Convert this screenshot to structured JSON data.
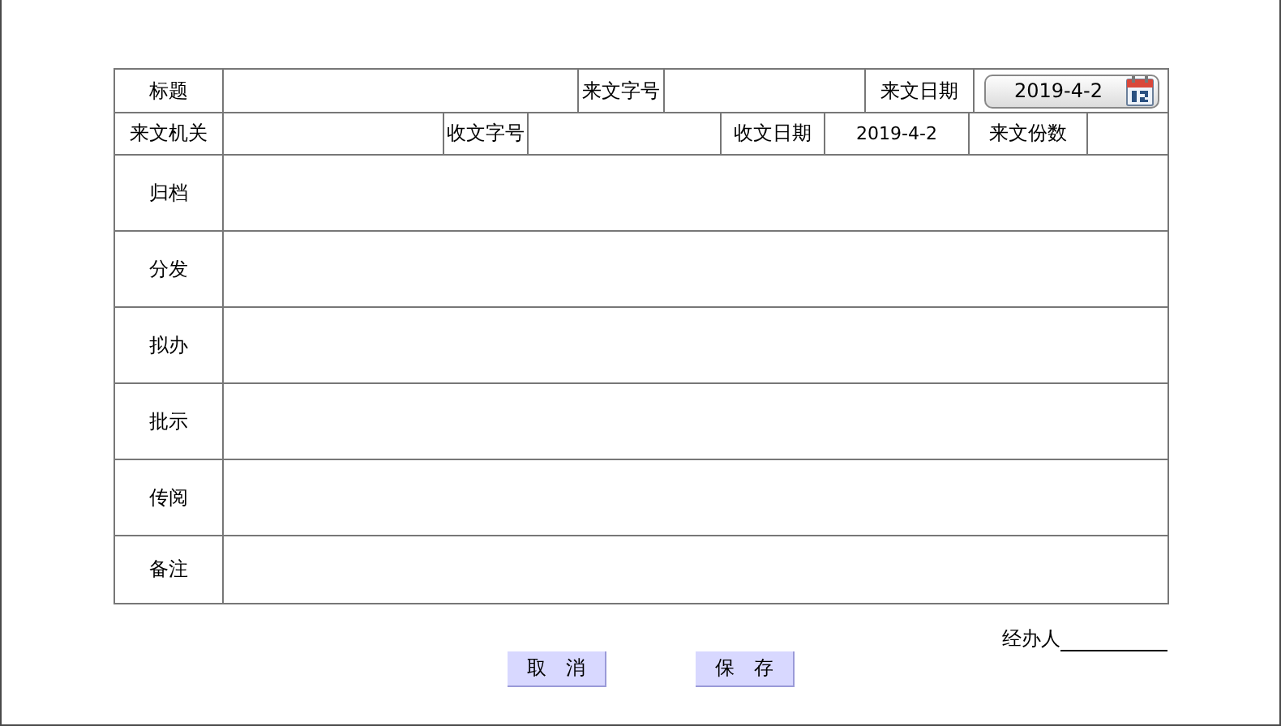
{
  "header_rows": [
    [
      {
        "kind": "label",
        "text": "标题"
      },
      {
        "kind": "field"
      },
      {
        "kind": "label",
        "text": "来文字号"
      },
      {
        "kind": "field"
      },
      {
        "kind": "label",
        "text": "来文日期"
      },
      {
        "kind": "date_picker",
        "value": "2019-4-2"
      }
    ],
    [
      {
        "kind": "label",
        "text": "来文机关"
      },
      {
        "kind": "field"
      },
      {
        "kind": "label",
        "text": "收文字号"
      },
      {
        "kind": "field"
      },
      {
        "kind": "label",
        "text": "收文日期"
      },
      {
        "kind": "value",
        "text": "2019-4-2"
      },
      {
        "kind": "label",
        "text": "来文份数"
      },
      {
        "kind": "field"
      }
    ]
  ],
  "sections": [
    {
      "label": "归档"
    },
    {
      "label": "分发"
    },
    {
      "label": "拟办"
    },
    {
      "label": "批示"
    },
    {
      "label": "传阅"
    },
    {
      "label": "备注"
    }
  ],
  "handler": {
    "label": "经办人"
  },
  "buttons": [
    "取　消",
    "保　存"
  ]
}
